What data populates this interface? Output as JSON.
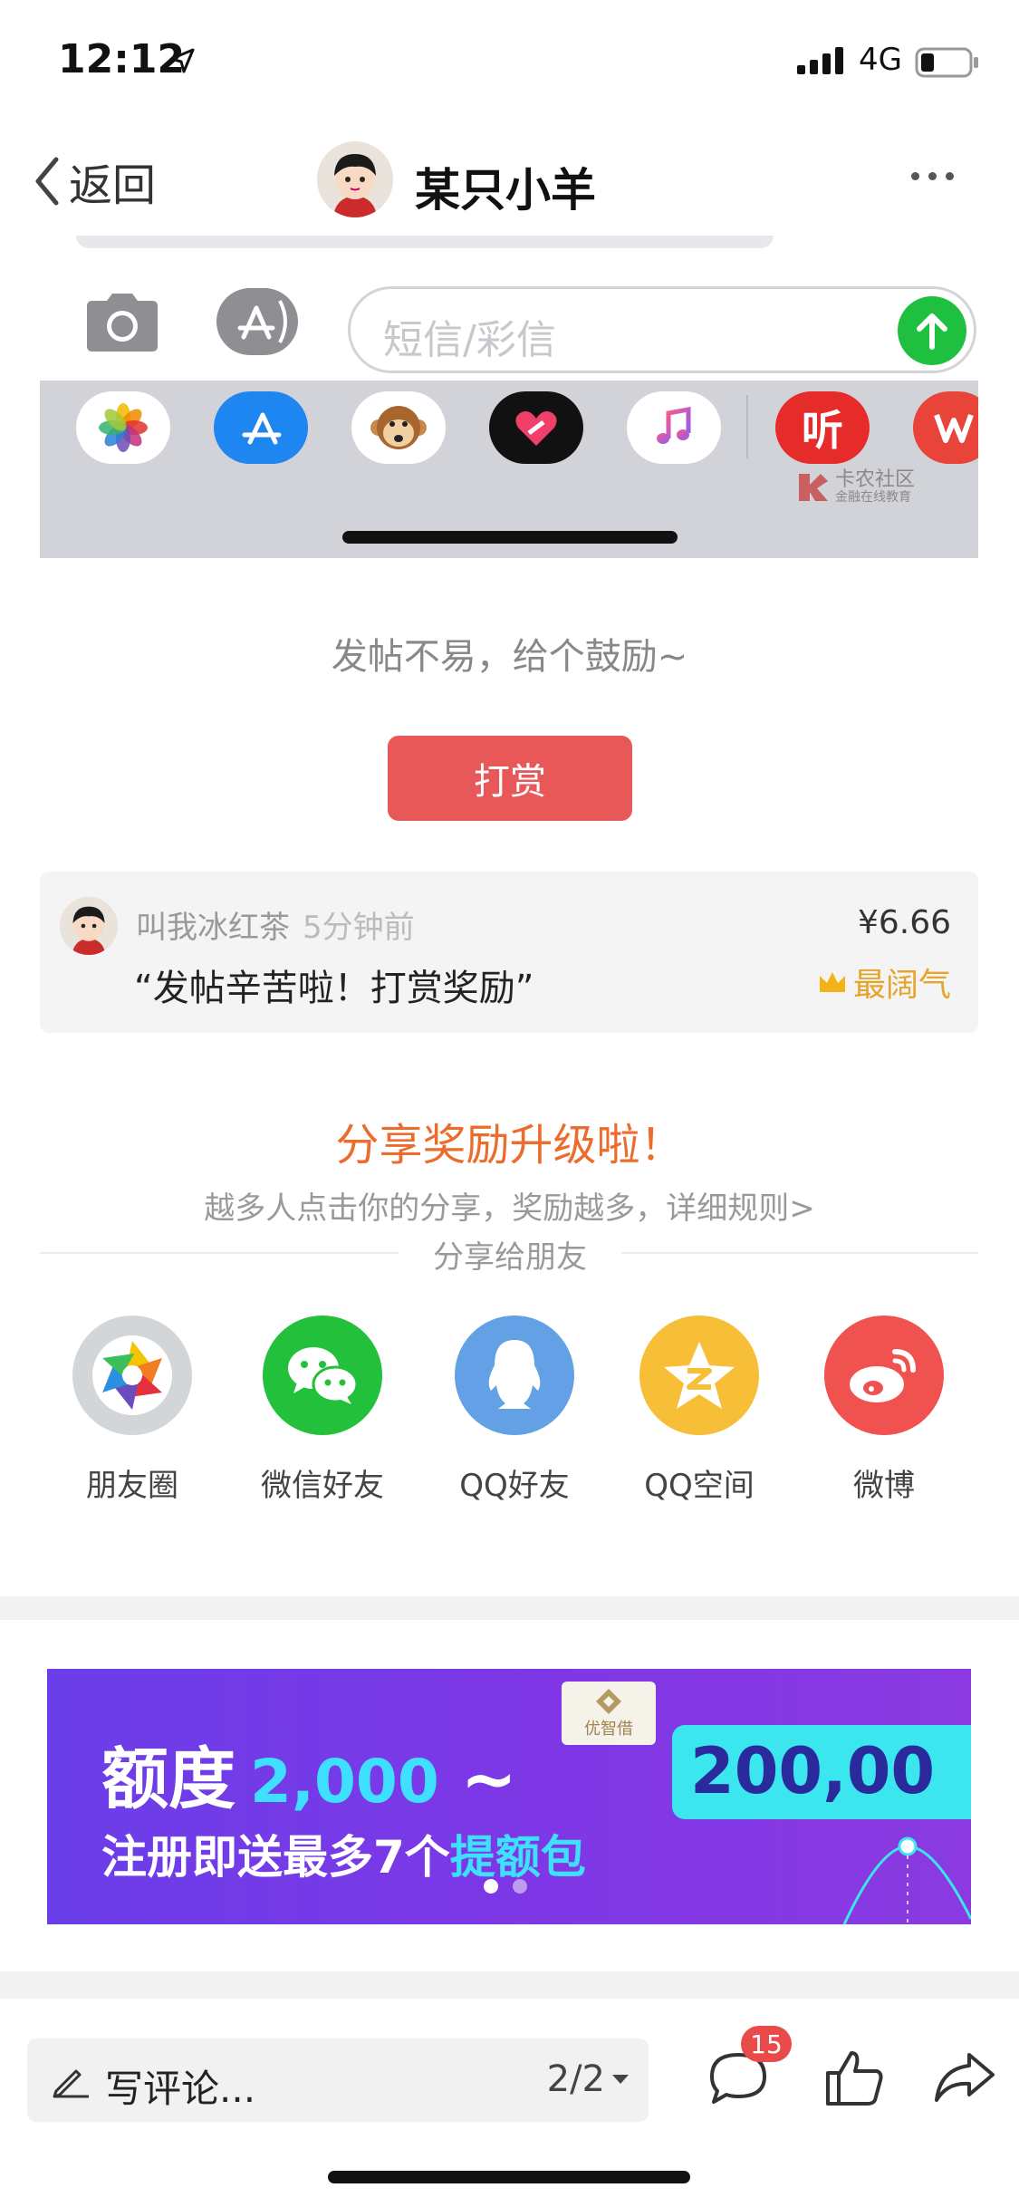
{
  "status_bar": {
    "time": "12:12",
    "network": "4G"
  },
  "nav": {
    "back_label": "返回",
    "title": "某只小羊"
  },
  "embed": {
    "sms_placeholder": "短信/彩信",
    "tray_apps": [
      "photos-icon",
      "appstore-icon",
      "monkey-memoji-icon",
      "heart-app-icon",
      "music-icon",
      "ting-app-icon",
      "weibo-app-icon"
    ],
    "tray_ting_label": "听",
    "watermark_lines": [
      "卡农社区",
      "金融在线教育"
    ]
  },
  "reward": {
    "prompt": "发帖不易，给个鼓励~",
    "button_label": "打赏"
  },
  "tip": {
    "user": "叫我冰红茶",
    "time": "5分钟前",
    "message": "“发帖辛苦啦！打赏奖励”",
    "amount": "¥6.66",
    "badge": "最阔气"
  },
  "share": {
    "title": "分享奖励升级啦！",
    "subtitle": "越多人点击你的分享，奖励越多，详细规则>",
    "to_friends": "分享给朋友",
    "targets": [
      {
        "label": "朋友圈",
        "color": "#cfd3d6"
      },
      {
        "label": "微信好友",
        "color": "#23c13b"
      },
      {
        "label": "QQ好友",
        "color": "#64a0e6"
      },
      {
        "label": "QQ空间",
        "color": "#f7be38"
      },
      {
        "label": "微博",
        "color": "#f0534f"
      }
    ]
  },
  "ad": {
    "logo_text": "优智借",
    "line1_prefix": "额度",
    "line1_from": "2,000",
    "line1_tilde": "~",
    "line1_to": "200,00",
    "line2_prefix": "注册即送最多7个",
    "line2_highlight": "提额包",
    "slides": 2,
    "active_slide": 1
  },
  "bottom_bar": {
    "comment_placeholder": "写评论...",
    "page_indicator": "2/2",
    "comment_count": "15"
  }
}
